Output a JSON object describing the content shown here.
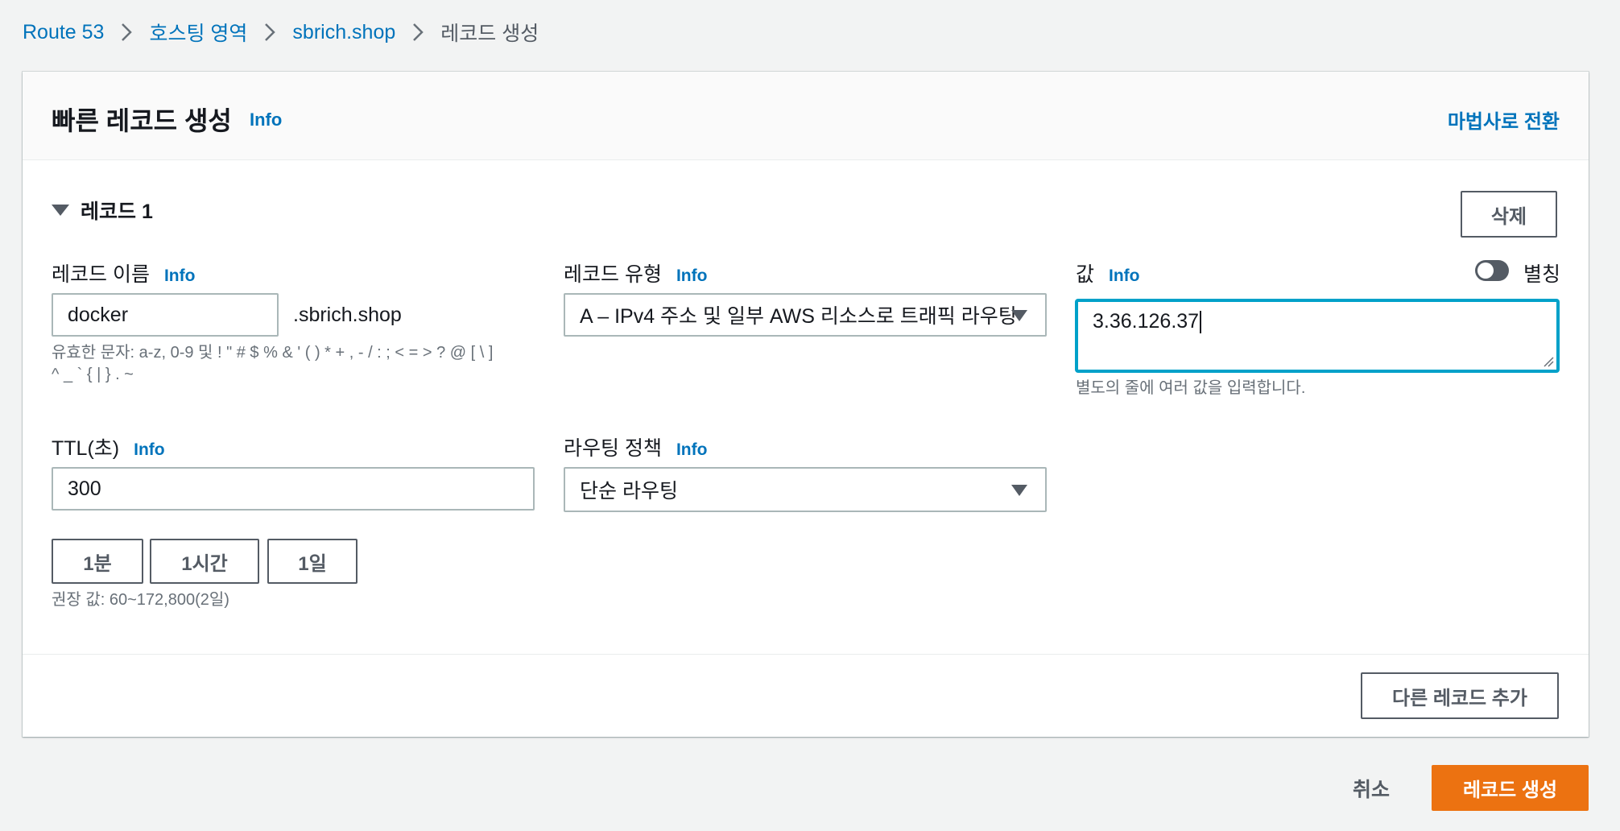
{
  "breadcrumb": {
    "items": [
      "Route 53",
      "호스팅 영역",
      "sbrich.shop"
    ],
    "current": "레코드 생성"
  },
  "panel": {
    "title": "빠른 레코드 생성",
    "info": "Info",
    "wizard_link": "마법사로 전환"
  },
  "record": {
    "title": "레코드 1",
    "delete_button": "삭제",
    "name": {
      "label": "레코드 이름",
      "info": "Info",
      "value": "docker",
      "suffix": ".sbrich.shop",
      "hint_line1": "유효한 문자: a-z, 0-9 및 ! \" # $ % & ' ( ) * + , - / : ; < = > ? @ [ \\ ]",
      "hint_line2": "^ _ ` { | } . ~"
    },
    "type": {
      "label": "레코드 유형",
      "info": "Info",
      "selected": "A – IPv4 주소 및 일부 AWS 리소스로 트래픽 라우팅"
    },
    "value": {
      "label": "값",
      "info": "Info",
      "alias_label": "별칭",
      "alias_enabled": false,
      "text": "3.36.126.37",
      "hint": "별도의 줄에 여러 값을 입력합니다."
    },
    "ttl": {
      "label": "TTL(초)",
      "info": "Info",
      "value": "300",
      "presets": [
        "1분",
        "1시간",
        "1일"
      ],
      "hint": "권장 값: 60~172,800(2일)"
    },
    "routing": {
      "label": "라우팅 정책",
      "info": "Info",
      "selected": "단순 라우팅"
    }
  },
  "add_record_button": "다른 레코드 추가",
  "footer": {
    "cancel": "취소",
    "create": "레코드 생성"
  },
  "colors": {
    "link": "#0073bb",
    "primary": "#ec7211",
    "focus": "#00a1c9"
  }
}
